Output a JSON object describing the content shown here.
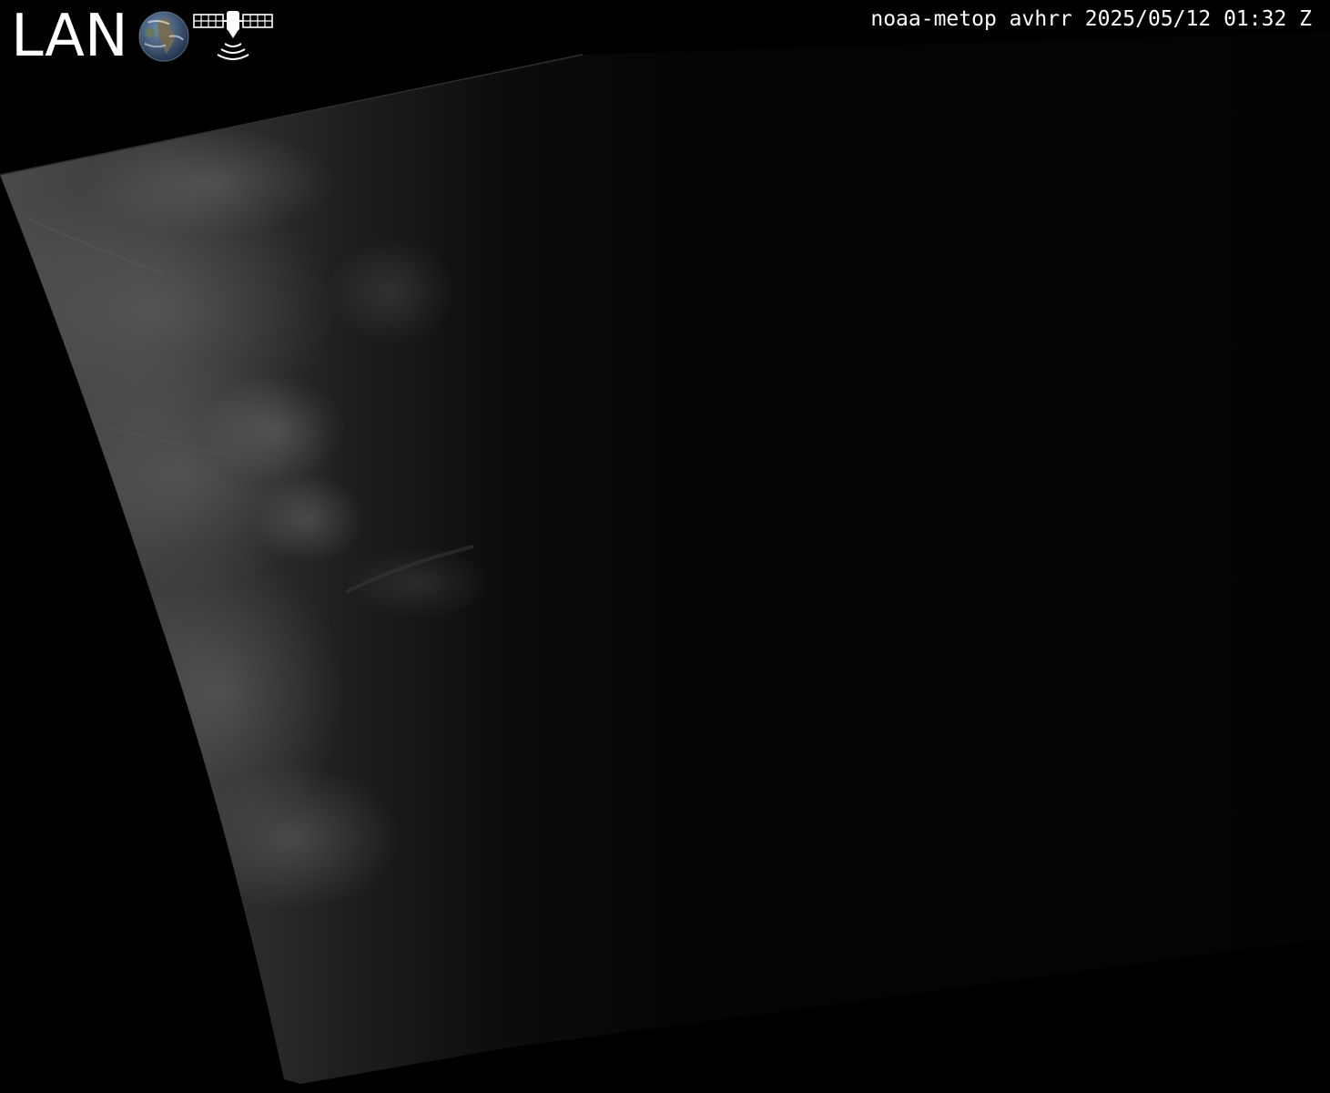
{
  "logo": {
    "text": "LAN",
    "globe_icon": "globe-icon",
    "satellite_icon": "satellite-icon",
    "color": "#ffffff"
  },
  "caption": {
    "text": "noaa-metop avhrr 2025/05/12 01:32 Z",
    "color": "#ffffff"
  },
  "colors": {
    "background": "#000000",
    "clouds": "#bdbdbd"
  }
}
